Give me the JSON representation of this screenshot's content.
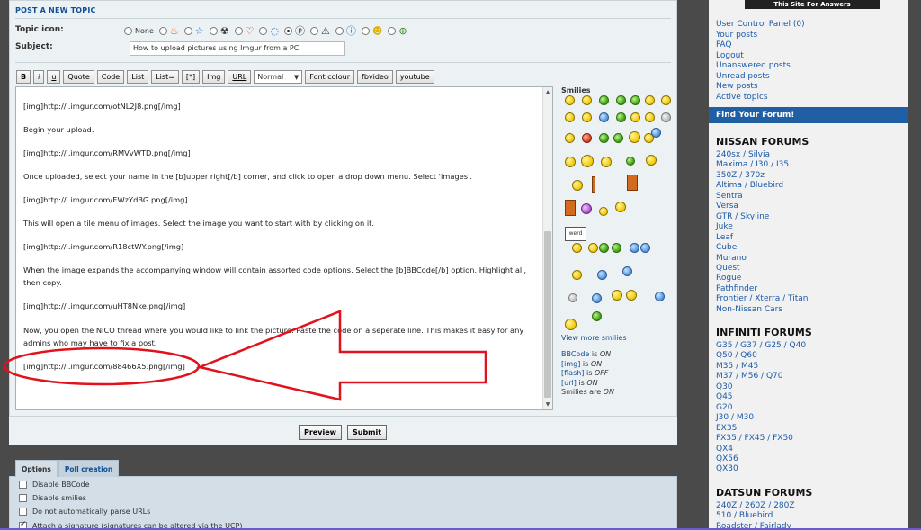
{
  "post_form": {
    "heading": "POST A NEW TOPIC",
    "topic_icon_label": "Topic icon:",
    "icon_none_label": "None",
    "icons": [
      "flame-icon",
      "star-icon",
      "radioactive-icon",
      "heart-icon",
      "speech-bubble-icon",
      "question-icon",
      "warning-icon",
      "info-icon",
      "wink-smiley-icon",
      "up-arrow-icon"
    ],
    "selected_icon": "question-icon",
    "subject_label": "Subject:",
    "subject_value": "How to upload pictures using Imgur from a PC"
  },
  "toolbar": {
    "bold": "B",
    "italic": "i",
    "underline": "u",
    "quote": "Quote",
    "code": "Code",
    "list": "List",
    "list_ordered": "List=",
    "list_item": "[*]",
    "img": "Img",
    "url": "URL",
    "font_size": "Normal",
    "font_colour": "Font colour",
    "fbvideo": "fbvideo",
    "youtube": "youtube"
  },
  "editor": {
    "lines": [
      "[img]http://i.imgur.com/otNL2J8.png[/img]",
      "Begin your upload.",
      "[img]http://i.imgur.com/RMVvWTD.png[/img]",
      "Once uploaded, select your name in the [b]upper right[/b] corner, and click to open a drop down menu. Select 'images'.",
      "[img]http://i.imgur.com/EWzYdBG.png[/img]",
      "This will open a tile menu of images. Select the image you want to start with by clicking on it.",
      "[img]http://i.imgur.com/R18ctWY.png[/img]",
      "When the image expands the accompanying window will contain assorted code options. Select the [b]BBCode[/b] option. Highlight all,",
      "then copy.",
      "[img]http://i.imgur.com/uHT8Nke.png[/img]",
      "Now, you open the NICO thread where you would like to link the picture. Paste the code on a seperate line. This makes it easy for any",
      "admins who may have to fix a post.",
      "[img]http://i.imgur.com/88466X5.png[/img]"
    ]
  },
  "smilies": {
    "title": "Smilies",
    "sign_text": "werd",
    "view_more": "View more smilies",
    "status": [
      {
        "key": "BBCode",
        "is": "is",
        "value": "ON"
      },
      {
        "key": "[img]",
        "is": "is",
        "value": "ON"
      },
      {
        "key": "[flash]",
        "is": "is",
        "value": "OFF"
      },
      {
        "key": "[url]",
        "is": "is",
        "value": "ON"
      },
      {
        "key": "Smilies are",
        "is": "",
        "value": "ON"
      }
    ]
  },
  "actions": {
    "preview": "Preview",
    "submit": "Submit"
  },
  "options": {
    "tabs": [
      "Options",
      "Poll creation"
    ],
    "items": [
      {
        "label": "Disable BBCode",
        "checked": false
      },
      {
        "label": "Disable smilies",
        "checked": false
      },
      {
        "label": "Do not automatically parse URLs",
        "checked": false
      },
      {
        "label": "Attach a signature (signatures can be altered via the UCP)",
        "checked": true
      }
    ]
  },
  "sidebar": {
    "banner": "This Site For Answers",
    "ucp_links": [
      "User Control Panel (0)",
      "Your posts",
      "FAQ",
      "Logout",
      "Unanswered posts",
      "Unread posts",
      "New posts",
      "Active topics"
    ],
    "find_forum": "Find Your Forum!",
    "nissan_heading": "NISSAN FORUMS",
    "nissan": [
      "240sx / Silvia",
      "Maxima / I30 / I35",
      "350Z / 370z",
      "Altima / Bluebird",
      "Sentra",
      "Versa",
      "GTR / Skyline",
      "Juke",
      "Leaf",
      "Cube",
      "Murano",
      "Quest",
      "Rogue",
      "Pathfinder",
      "Frontier / Xterra / Titan",
      "Non-Nissan Cars"
    ],
    "infiniti_heading": "INFINITI FORUMS",
    "infiniti": [
      "G35 / G37 / G25 / Q40",
      "Q50 / Q60",
      "M35 / M45",
      "M37 / M56 / Q70",
      "Q30",
      "Q45",
      "G20",
      "J30 / M30",
      "EX35",
      "FX35 / FX45 / FX50",
      "QX4",
      "QX56",
      "QX30"
    ],
    "datsun_heading": "DATSUN FORUMS",
    "datsun": [
      "240Z / 260Z / 280Z",
      "510 / Bluebird",
      "Roadster / Fairlady"
    ]
  },
  "colors": {
    "link": "#1a5aa8",
    "find_bar": "#215fa5",
    "annotation": "#e0121b"
  }
}
